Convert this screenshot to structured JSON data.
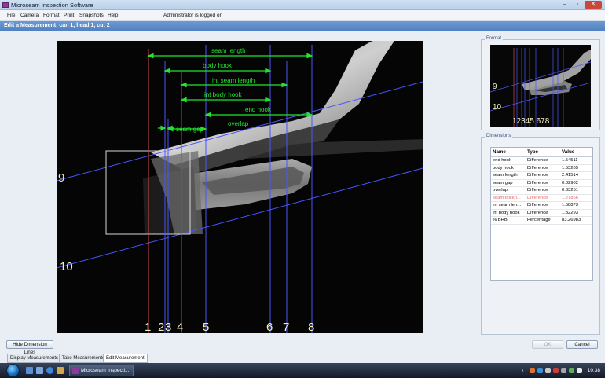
{
  "window": {
    "title": "Microseam Inspection Software",
    "buttons": {
      "minimize": "–",
      "maximize": "▫",
      "close": "✕"
    }
  },
  "menu": {
    "items": [
      "File",
      "Camera",
      "Format",
      "Print",
      "Snapshots",
      "Help"
    ],
    "status": "Administrator is logged on"
  },
  "header": {
    "title": "Edit a Measurement: can 1, head 1, cut 2"
  },
  "viewer": {
    "measurements": [
      "seam length",
      "body hook",
      "int seam length",
      "int body hook",
      "end hook",
      "overlap",
      "seam gap"
    ],
    "vertical_labels": [
      "1",
      "2",
      "3",
      "4",
      "5",
      "6",
      "7",
      "8"
    ],
    "line_labels": [
      "9",
      "10"
    ]
  },
  "format_panel": {
    "title": "Format",
    "line_labels": [
      "9",
      "10"
    ],
    "vertical_labels": "12345 678"
  },
  "dimensions_panel": {
    "title": "Dimensions",
    "columns": [
      "Name",
      "Type",
      "Value"
    ],
    "rows": [
      {
        "name": "end hook",
        "type": "Difference",
        "value": "1.54511"
      },
      {
        "name": "body hook",
        "type": "Difference",
        "value": "1.53265"
      },
      {
        "name": "seam length",
        "type": "Difference",
        "value": "2.41514"
      },
      {
        "name": "seam gap",
        "type": "Difference",
        "value": "0.02902"
      },
      {
        "name": "overlap",
        "type": "Difference",
        "value": "0.83251"
      },
      {
        "name": "seam thickn...",
        "type": "Difference",
        "value": "1.27856",
        "highlight": true
      },
      {
        "name": "int seam len...",
        "type": "Difference",
        "value": "1.58873"
      },
      {
        "name": "int body hook",
        "type": "Difference",
        "value": "1.32293"
      },
      {
        "name": "% BHB",
        "type": "Percentage",
        "value": "83.26983"
      }
    ]
  },
  "buttons": {
    "hide_dimension_lines": "Hide Dimension Lines",
    "ok": "OK",
    "cancel": "Cancel"
  },
  "tabs": [
    "Display Measurements",
    "Take Measurements",
    "Edit Measurement"
  ],
  "taskbar": {
    "app_label": "Microseam Inspecti...",
    "clock": "10:38",
    "tray_arrow": "‹"
  },
  "colors": {
    "header_blue": "#5585c4",
    "measurement_green": "#23e52d",
    "vertical_line_blue": "#4a55ff",
    "vertical_line_red": "#d24a4a",
    "highlight_red": "#e86a6a",
    "label_yellow": "#f2f1c5"
  }
}
